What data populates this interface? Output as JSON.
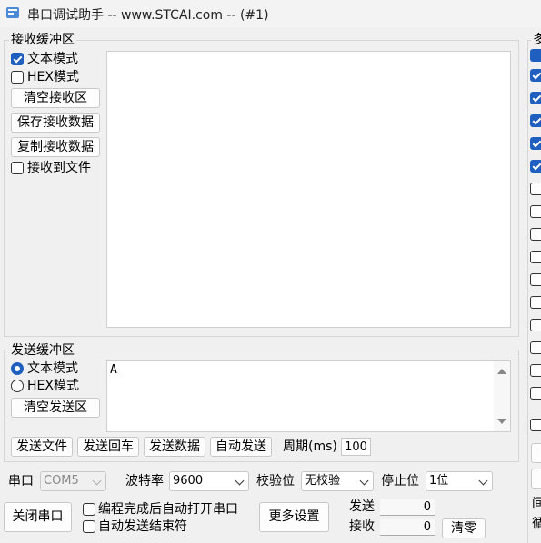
{
  "window": {
    "title": "串口调试助手 -- www.STCAI.com -- (#1)"
  },
  "receive": {
    "group_label": "接收缓冲区",
    "text_mode": "文本模式",
    "hex_mode": "HEX模式",
    "clear_btn": "清空接收区",
    "save_btn": "保存接收数据",
    "copy_btn": "复制接收数据",
    "to_file": "接收到文件",
    "text_mode_checked": true,
    "hex_mode_checked": false,
    "to_file_checked": false,
    "content": ""
  },
  "send": {
    "group_label": "发送缓冲区",
    "text_mode": "文本模式",
    "hex_mode": "HEX模式",
    "clear_btn": "清空发送区",
    "content": "A",
    "selected_mode": "text",
    "buttons": {
      "send_file": "发送文件",
      "send_enter": "发送回车",
      "send_data": "发送数据",
      "auto_send": "自动发送"
    },
    "period_label": "周期(ms)",
    "period_value": "100"
  },
  "port": {
    "port_label": "串口",
    "port_value": "COM5",
    "baud_label": "波特率",
    "baud_value": "9600",
    "parity_label": "校验位",
    "parity_value": "无校验",
    "stop_label": "停止位",
    "stop_value": "1位",
    "close_btn": "关闭串口",
    "auto_open": "编程完成后自动打开串口",
    "auto_send_end": "自动发送结束符",
    "more_btn": "更多设置",
    "sent_label": "发送",
    "sent_value": "0",
    "recv_label": "接收",
    "recv_value": "0",
    "clear_btn": "清零"
  },
  "right_panel": {
    "group_label_partial": "多",
    "bottom_text_1": "间",
    "bottom_text_2": "循",
    "checkbox_states": [
      true,
      true,
      true,
      true,
      true,
      false,
      false,
      false,
      false,
      false,
      false,
      false,
      false,
      false,
      false,
      false
    ]
  },
  "colors": {
    "accent": "#1f5fbf",
    "background": "#f0f0f0"
  }
}
